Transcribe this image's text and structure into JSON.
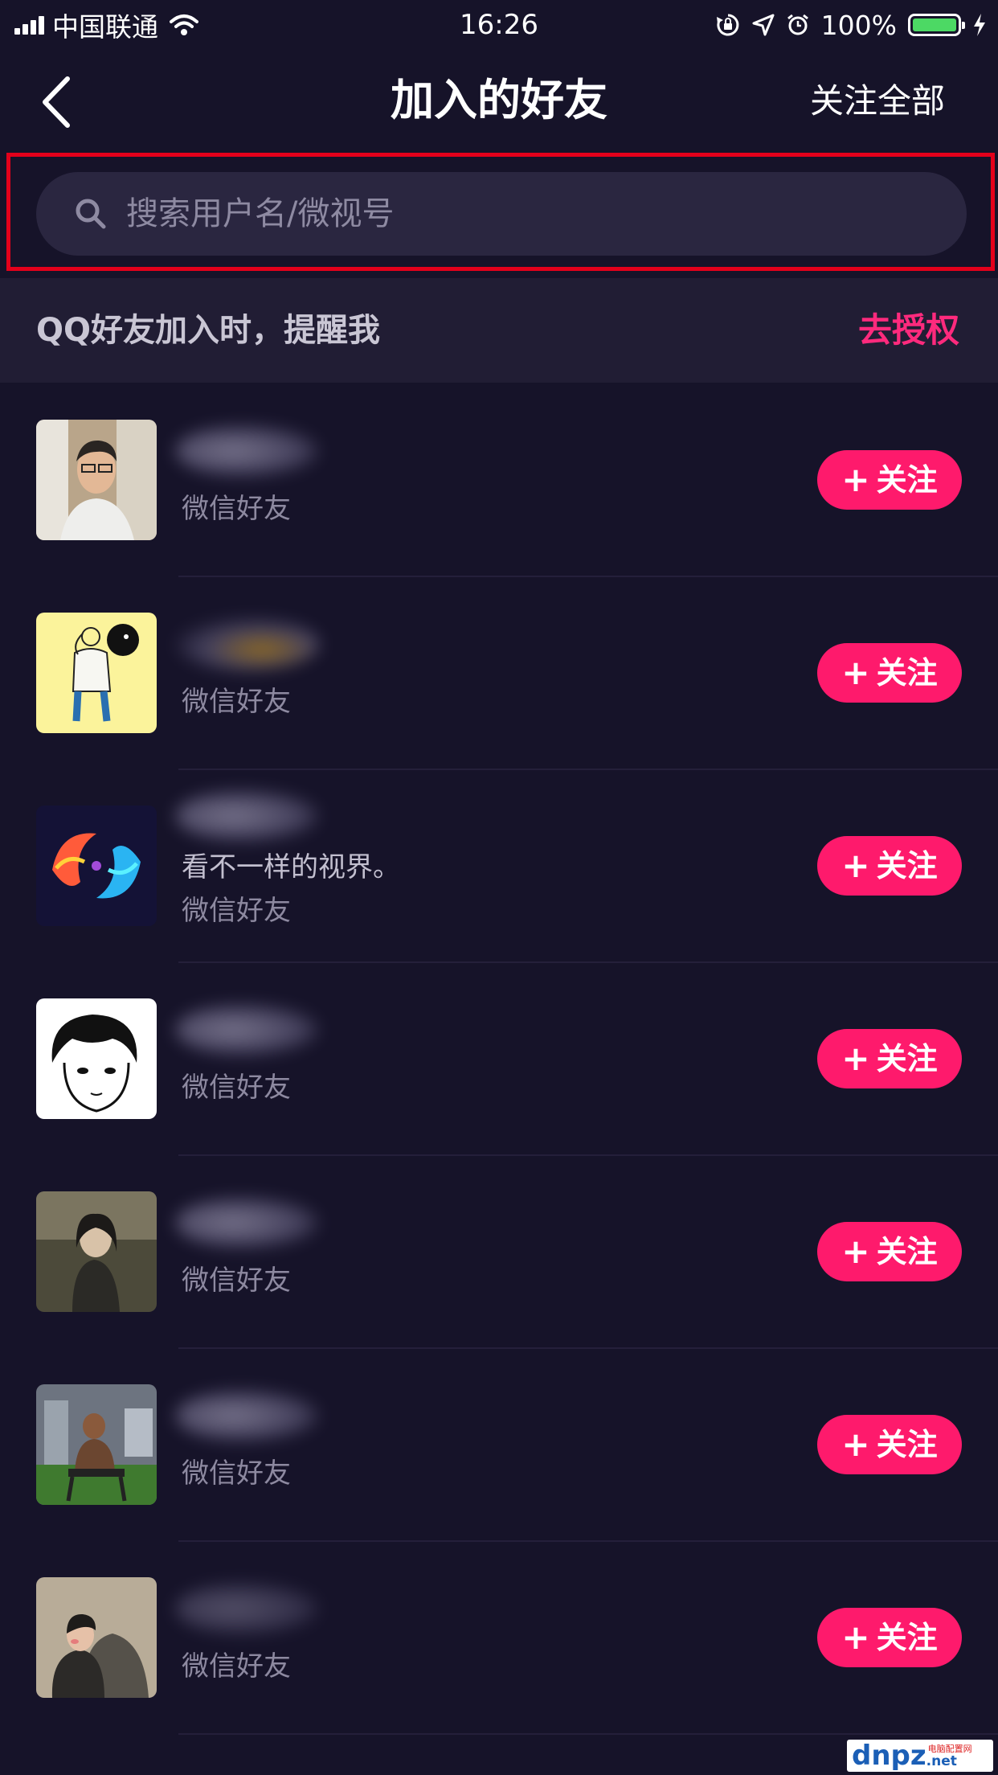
{
  "status_bar": {
    "carrier": "中国联通",
    "time": "16:26",
    "battery": "100%",
    "battery_level": 1.0,
    "battery_color": "#4cd964"
  },
  "nav": {
    "back_icon": "chevron-left-icon",
    "title": "加入的好友",
    "action": "关注全部"
  },
  "search": {
    "placeholder": "搜索用户名/微视号",
    "value": ""
  },
  "qq_prompt": {
    "text": "QQ好友加入时，提醒我",
    "link": "去授权",
    "link_color": "#ff2a7d"
  },
  "friends": [
    {
      "avatar": "photo-young-man",
      "bio": "",
      "source": "微信好友",
      "follow": "关注"
    },
    {
      "avatar": "drawing-yellow-boy",
      "bio": "",
      "source": "微信好友",
      "follow": "关注"
    },
    {
      "avatar": "koi-fish-art",
      "bio": "看不一样的视界。",
      "source": "微信好友",
      "follow": "关注"
    },
    {
      "avatar": "sketch-boy-face",
      "bio": "",
      "source": "微信好友",
      "follow": "关注"
    },
    {
      "avatar": "anime-girl-dusk",
      "bio": "",
      "source": "微信好友",
      "follow": "关注"
    },
    {
      "avatar": "photo-gym-man",
      "bio": "",
      "source": "微信好友",
      "follow": "关注"
    },
    {
      "avatar": "drawing-couple",
      "bio": "",
      "source": "微信好友",
      "follow": "关注"
    }
  ],
  "colors": {
    "background": "#161329",
    "follow_button": "#fe1a6c",
    "search_highlight": "#e3001b"
  },
  "watermark": {
    "logo": "dnpz",
    "small": "电脑配置网",
    "net": ".net"
  }
}
